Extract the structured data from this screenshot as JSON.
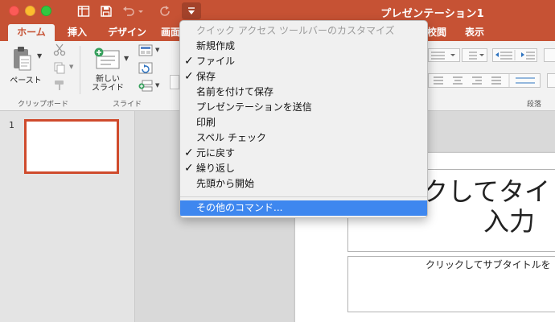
{
  "window": {
    "title": "プレゼンテーション1"
  },
  "tabs": [
    {
      "label": "ホーム",
      "active": true
    },
    {
      "label": "挿入"
    },
    {
      "label": "デザイン"
    },
    {
      "label": "画面"
    },
    {
      "label": "校閲"
    },
    {
      "label": "表示"
    }
  ],
  "ribbon": {
    "paste_label": "ペースト",
    "new_slide_label_line1": "新しい",
    "new_slide_label_line2": "スライド",
    "group_clipboard": "クリップボード",
    "group_slides": "スライド",
    "group_paragraph": "段落"
  },
  "slides_pane": {
    "slide_number": "1"
  },
  "slide": {
    "title_line1": "ックしてタイ",
    "title_line2": "入力",
    "subtitle": "クリックしてサブタイトルを"
  },
  "qat_menu": {
    "header": "クイック アクセス ツールバーのカスタマイズ",
    "items": [
      {
        "label": "新規作成",
        "checked": false
      },
      {
        "label": "ファイル",
        "checked": true
      },
      {
        "label": "保存",
        "checked": true
      },
      {
        "label": "名前を付けて保存",
        "checked": false
      },
      {
        "label": "プレゼンテーションを送信",
        "checked": false
      },
      {
        "label": "印刷",
        "checked": false
      },
      {
        "label": "スペル チェック",
        "checked": false
      },
      {
        "label": "元に戻す",
        "checked": true
      },
      {
        "label": "繰り返し",
        "checked": true
      },
      {
        "label": "先頭から開始",
        "checked": false
      }
    ],
    "more_commands": "その他のコマンド...",
    "check_glyph": "✓"
  },
  "colors": {
    "accent": "#c65234",
    "menu_highlight": "#3e87ef",
    "thumb_border": "#cf4b2d"
  }
}
